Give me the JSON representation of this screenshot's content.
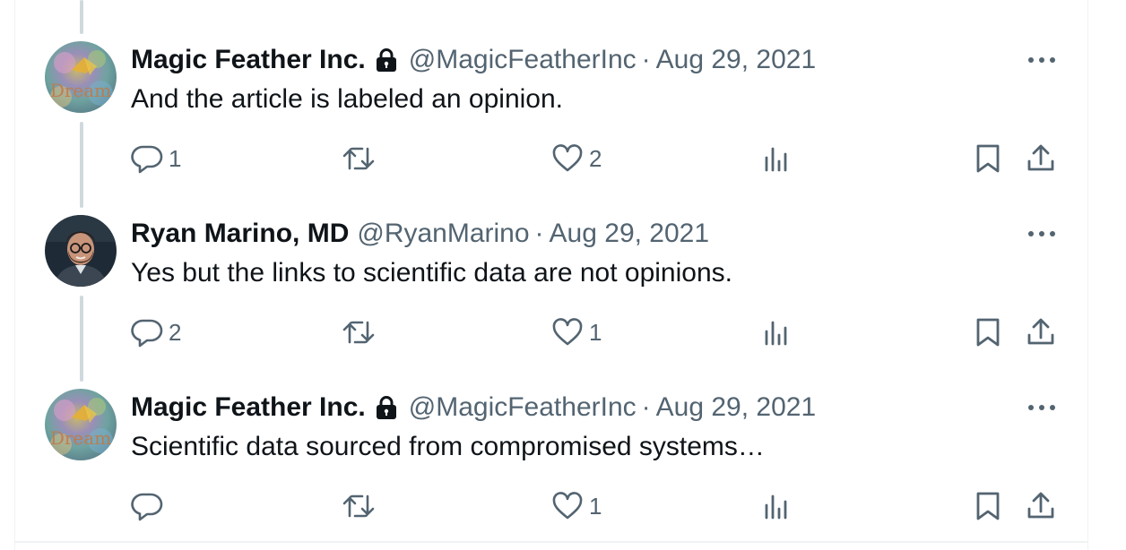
{
  "icons": {
    "lock": "lock-icon",
    "more": "more-icon",
    "reply": "reply-icon",
    "retweet": "retweet-icon",
    "like": "heart-icon",
    "views": "views-icon",
    "bookmark": "bookmark-icon",
    "share": "share-icon"
  },
  "colors": {
    "text": "#0f1419",
    "secondary": "#536471",
    "thread_line": "#cfd9de",
    "border": "#eff3f4"
  },
  "tweets": [
    {
      "name": "Magic Feather Inc.",
      "protected": true,
      "handle": "@MagicFeatherInc",
      "separator": "·",
      "date": "Aug 29, 2021",
      "text": "And the article is labeled an opinion.",
      "replies": "1",
      "retweets": "",
      "likes": "2",
      "avatar_text": "Dream"
    },
    {
      "name": "Ryan Marino, MD",
      "protected": false,
      "handle": "@RyanMarino",
      "separator": "·",
      "date": "Aug 29, 2021",
      "text": "Yes but the links to scientific data are not opinions.",
      "replies": "2",
      "retweets": "",
      "likes": "1"
    },
    {
      "name": "Magic Feather Inc.",
      "protected": true,
      "handle": "@MagicFeatherInc",
      "separator": "·",
      "date": "Aug 29, 2021",
      "text": "Scientific data sourced from compromised systems…",
      "replies": "",
      "retweets": "",
      "likes": "1",
      "avatar_text": "Dream"
    }
  ]
}
